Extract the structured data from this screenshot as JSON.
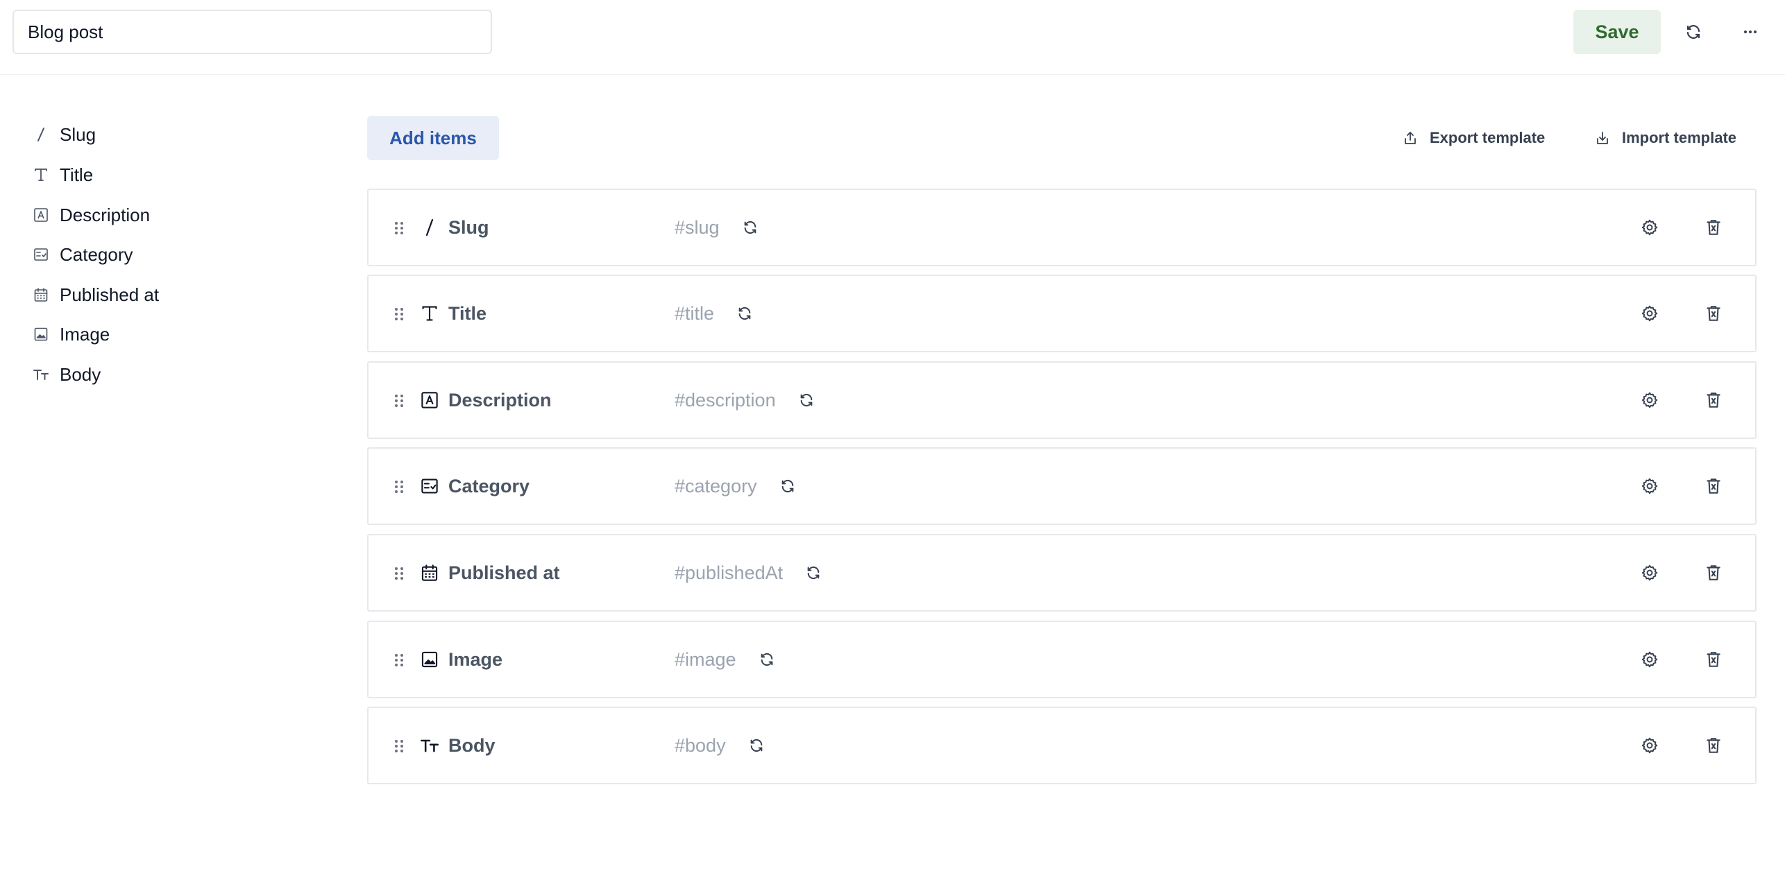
{
  "header": {
    "name_value": "Blog post",
    "save_label": "Save",
    "refresh_icon": "refresh-icon",
    "more_icon": "more-horizontal-icon"
  },
  "sidebar": {
    "items": [
      {
        "label": "Slug",
        "icon": "slash-icon"
      },
      {
        "label": "Title",
        "icon": "text-type-icon"
      },
      {
        "label": "Description",
        "icon": "text-box-icon"
      },
      {
        "label": "Category",
        "icon": "select-list-icon"
      },
      {
        "label": "Published at",
        "icon": "calendar-icon"
      },
      {
        "label": "Image",
        "icon": "image-icon"
      },
      {
        "label": "Body",
        "icon": "rich-text-icon"
      }
    ]
  },
  "toolbar": {
    "add_label": "Add items",
    "export_label": "Export template",
    "import_label": "Import template"
  },
  "fields": [
    {
      "label": "Slug",
      "api": "#slug",
      "icon": "slash-icon"
    },
    {
      "label": "Title",
      "api": "#title",
      "icon": "text-type-icon"
    },
    {
      "label": "Description",
      "api": "#description",
      "icon": "text-box-icon"
    },
    {
      "label": "Category",
      "api": "#category",
      "icon": "select-list-icon"
    },
    {
      "label": "Published at",
      "api": "#publishedAt",
      "icon": "calendar-icon"
    },
    {
      "label": "Image",
      "api": "#image",
      "icon": "image-icon"
    },
    {
      "label": "Body",
      "api": "#body",
      "icon": "rich-text-icon"
    }
  ],
  "colors": {
    "save_bg": "#e9f2ea",
    "save_text": "#2f6b2f",
    "add_bg": "#e8edf8",
    "add_text": "#2d56a8",
    "border": "#e6e8ec"
  }
}
